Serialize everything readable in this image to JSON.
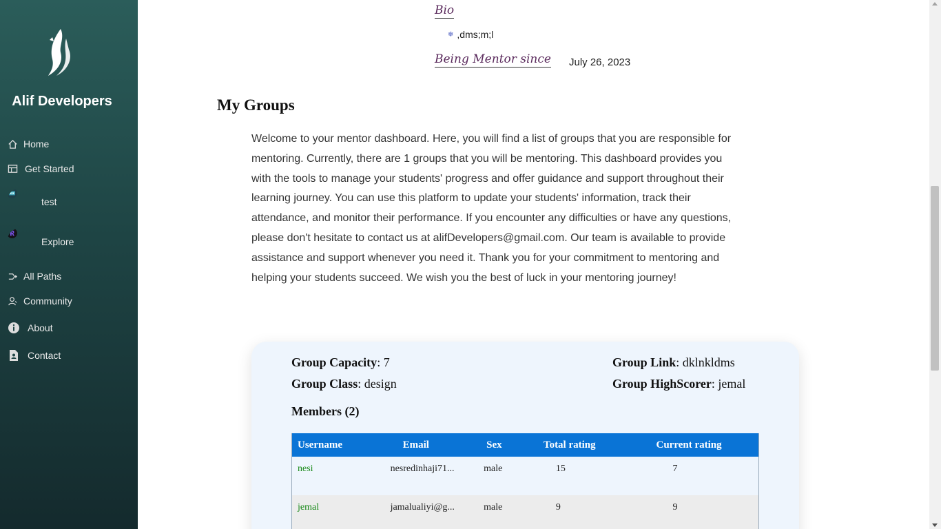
{
  "sidebar": {
    "brand": "Alif Developers",
    "items": [
      {
        "label": "Home",
        "icon": "home-icon"
      },
      {
        "label": "Get Started",
        "icon": "table-icon"
      },
      {
        "label": "test",
        "icon": "avatar-test"
      },
      {
        "label": "Explore",
        "icon": "avatar-r-logo"
      },
      {
        "label": "All Paths",
        "icon": "paths-icon"
      },
      {
        "label": "Community",
        "icon": "community-icon"
      },
      {
        "label": "About",
        "icon": "info-icon"
      },
      {
        "label": "Contact",
        "icon": "contact-icon"
      }
    ]
  },
  "profile": {
    "bio_label": "Bio",
    "bio_item": ",dms;m;l",
    "mentor_label": "Being Mentor since",
    "mentor_date": "July 26, 2023"
  },
  "groups": {
    "title": "My Groups",
    "intro": "Welcome to your mentor dashboard. Here, you will find a list of groups that you are responsible for mentoring. Currently, there are 1 groups that you will be mentoring. This dashboard provides you with the tools to manage your students' progress and offer guidance and support throughout their learning journey. You can use this platform to update your students' information, track their attendance, and monitor their performance. If you encounter any difficulties or have any questions, please don't hesitate to contact us at alifDevelopers@gmail.com. Our team is available to provide assistance and support whenever you need it. Thank you for your commitment to mentoring and helping your students succeed. We wish you the best of luck in your mentoring journey!",
    "card": {
      "capacity_label": "Group Capacity",
      "capacity_value": ": 7",
      "class_label": "Group Class",
      "class_value": ": design",
      "link_label": "Group Link",
      "link_value": ": dklnkldms",
      "highscorer_label": "Group HighScorer",
      "highscorer_value": ": jemal",
      "members_title": "Members (2)",
      "columns": [
        "Username",
        "Email",
        "Sex",
        "Total rating",
        "Current rating"
      ],
      "rows": [
        {
          "username": "nesi",
          "email": "nesredinhaji71...",
          "sex": "male",
          "total": "15",
          "current": "7"
        },
        {
          "username": "jemal",
          "email": "jamalualiyi@g...",
          "sex": "male",
          "total": "9",
          "current": "9"
        }
      ]
    }
  },
  "colors": {
    "sidebar_top": "#2b5d5a",
    "sidebar_bottom": "#142a2d",
    "table_header": "#0a74d6",
    "username_green": "#1a8a1a",
    "card_bg": "#eef5fd",
    "heading_purple": "#5a2a5c"
  }
}
